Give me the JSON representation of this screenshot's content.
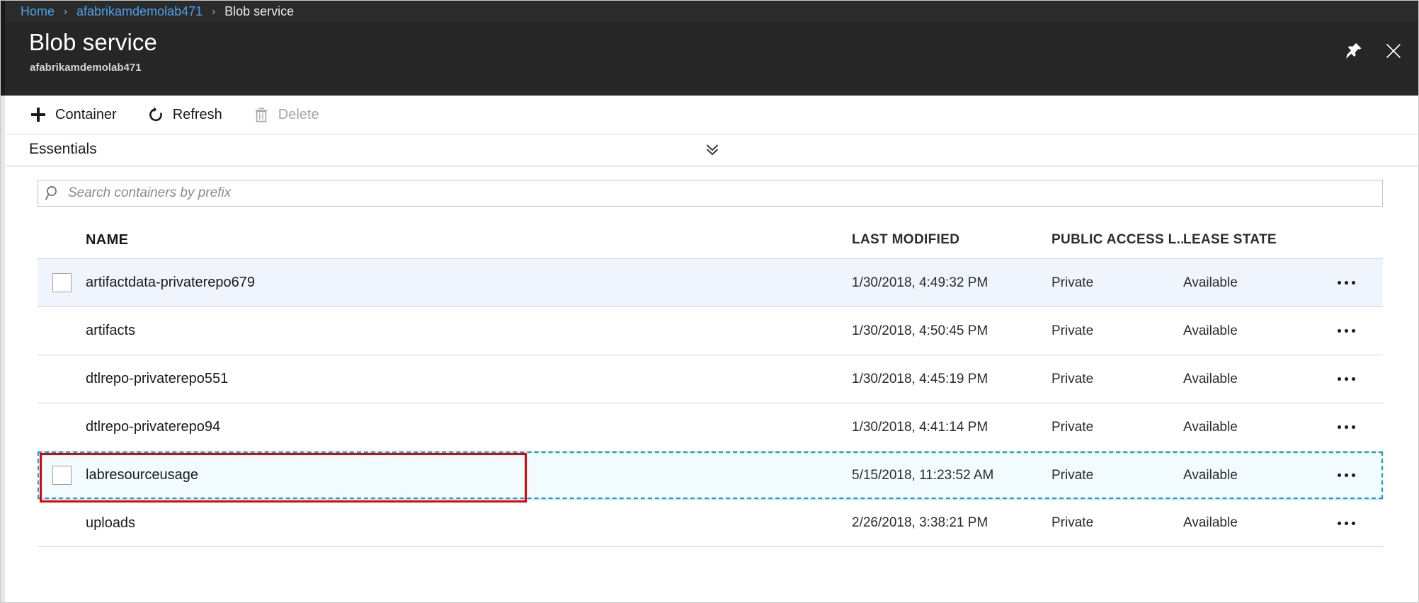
{
  "breadcrumb": {
    "items": [
      {
        "label": "Home",
        "link": true
      },
      {
        "label": "afabrikamdemolab471",
        "link": true
      },
      {
        "label": "Blob service",
        "link": false
      }
    ],
    "separator": "›"
  },
  "header": {
    "title": "Blob service",
    "subtitle": "afabrikamdemolab471",
    "pin_icon": "pin-icon",
    "close_icon": "close-icon"
  },
  "toolbar": {
    "container_label": "Container",
    "container_icon": "plus-icon",
    "refresh_label": "Refresh",
    "refresh_icon": "refresh-icon",
    "delete_label": "Delete",
    "delete_icon": "trash-icon",
    "delete_disabled": true
  },
  "essentials": {
    "label": "Essentials",
    "toggle_icon": "double-chevron-down-icon"
  },
  "search": {
    "placeholder": "Search containers by prefix",
    "value": "",
    "icon": "search-icon"
  },
  "table": {
    "columns": {
      "name": "NAME",
      "last_modified": "LAST MODIFIED",
      "public_access": "PUBLIC ACCESS L...",
      "lease_state": "LEASE STATE"
    },
    "rows": [
      {
        "name": "artifactdata-privaterepo679",
        "last_modified": "1/30/2018, 4:49:32 PM",
        "public_access": "Private",
        "lease_state": "Available",
        "state": "hover",
        "checkbox": true,
        "menu": "more-options-icon"
      },
      {
        "name": "artifacts",
        "last_modified": "1/30/2018, 4:50:45 PM",
        "public_access": "Private",
        "lease_state": "Available",
        "state": "normal",
        "checkbox": false,
        "menu": "more-options-icon"
      },
      {
        "name": "dtlrepo-privaterepo551",
        "last_modified": "1/30/2018, 4:45:19 PM",
        "public_access": "Private",
        "lease_state": "Available",
        "state": "normal",
        "checkbox": false,
        "menu": "more-options-icon"
      },
      {
        "name": "dtlrepo-privaterepo94",
        "last_modified": "1/30/2018, 4:41:14 PM",
        "public_access": "Private",
        "lease_state": "Available",
        "state": "normal",
        "checkbox": false,
        "menu": "more-options-icon"
      },
      {
        "name": "labresourceusage",
        "last_modified": "5/15/2018, 11:23:52 AM",
        "public_access": "Private",
        "lease_state": "Available",
        "state": "selected",
        "checkbox": true,
        "menu": "more-options-icon"
      },
      {
        "name": "uploads",
        "last_modified": "2/26/2018, 3:38:21 PM",
        "public_access": "Private",
        "lease_state": "Available",
        "state": "normal",
        "checkbox": false,
        "menu": "more-options-icon"
      }
    ]
  },
  "colors": {
    "breadcrumb_link": "#4ba0e8",
    "header_background": "#262626",
    "hover_row": "#eff4fd",
    "selected_row": "#f2fbfd",
    "focus_outline": "#00a2e8",
    "annotation": "#e60000"
  }
}
